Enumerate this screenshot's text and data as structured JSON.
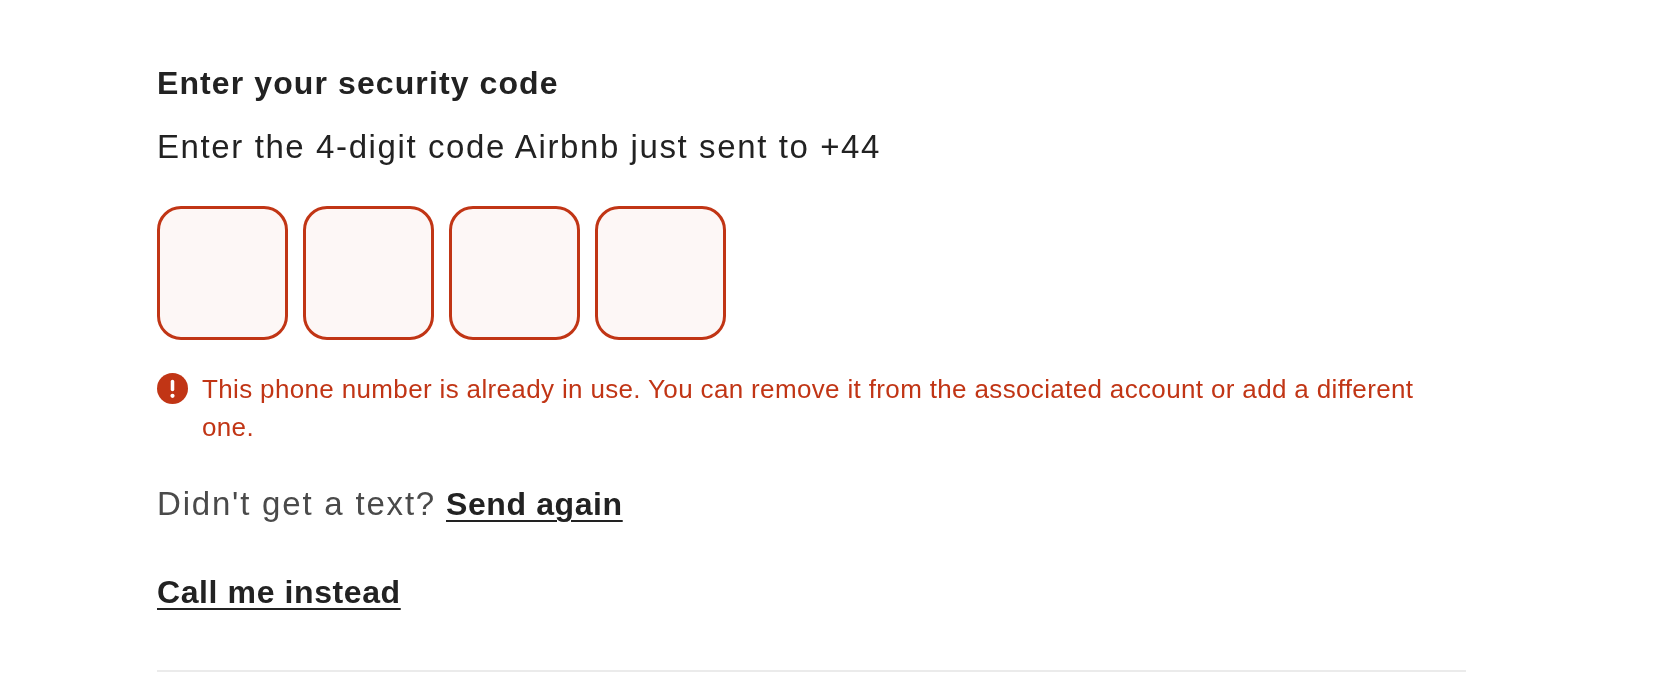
{
  "heading": "Enter your security code",
  "instructions": "Enter the 4-digit code Airbnb just sent to +44",
  "code_inputs": [
    {
      "invalid": true
    },
    {
      "invalid": true
    },
    {
      "invalid": true
    },
    {
      "invalid": true
    }
  ],
  "error": {
    "message": "This phone number is already in use. You can remove it from the associated account or add a different one."
  },
  "resend": {
    "prompt": "Didn't get a text?",
    "link": "Send again"
  },
  "call_link": "Call me instead"
}
